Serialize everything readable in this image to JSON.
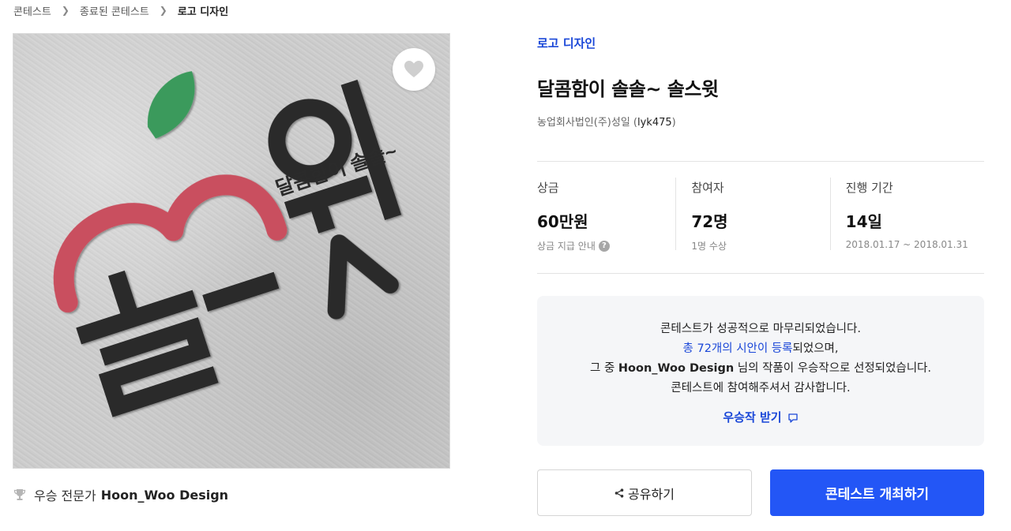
{
  "breadcrumb": {
    "items": [
      "콘테스트",
      "종료된 콘테스트",
      "로고 디자인"
    ]
  },
  "image": {
    "logo_slogan": "달콤함이 솔솔~",
    "logo_wordmark": "솔스윗",
    "colors": {
      "apple_red": "#c9505f",
      "leaf_green": "#3b9a5c",
      "ink_dark": "#2b2b2b",
      "paper": "#cccccc"
    }
  },
  "winner": {
    "label": "우승 전문가",
    "name": "Hoon_Woo Design"
  },
  "contest": {
    "category": "로고 디자인",
    "title": "달콤함이 솔솔~ 솔스윗",
    "host_name": "농업회사법인(주)성일 (",
    "host_handle": "lyk475",
    "host_close": ")"
  },
  "stats": {
    "prize": {
      "label": "상금",
      "value": "60만원",
      "sub": "상금 지급 안내",
      "help": "?"
    },
    "participants": {
      "label": "참여자",
      "value": "72명",
      "sub": "1명 수상"
    },
    "period": {
      "label": "진행 기간",
      "value": "14일",
      "sub": "2018.01.17 ~ 2018.01.31"
    }
  },
  "notice": {
    "line1": "콘테스트가 성공적으로 마무리되었습니다.",
    "line2_highlight": "총 72개의 시안이 등록",
    "line2_rest": "되었으며,",
    "line3_pre": "그 중 ",
    "line3_name": "Hoon_Woo Design",
    "line3_post": " 님의 작품이 우승작으로 선정되었습니다.",
    "line4": "콘테스트에 참여해주셔서 감사합니다.",
    "get_winner_label": "우승작 받기"
  },
  "actions": {
    "share_label": "공유하기",
    "host_contest_label": "콘테스트 개최하기"
  },
  "theme": {
    "accent": "#2356f6",
    "link_blue": "#1a47d8"
  }
}
